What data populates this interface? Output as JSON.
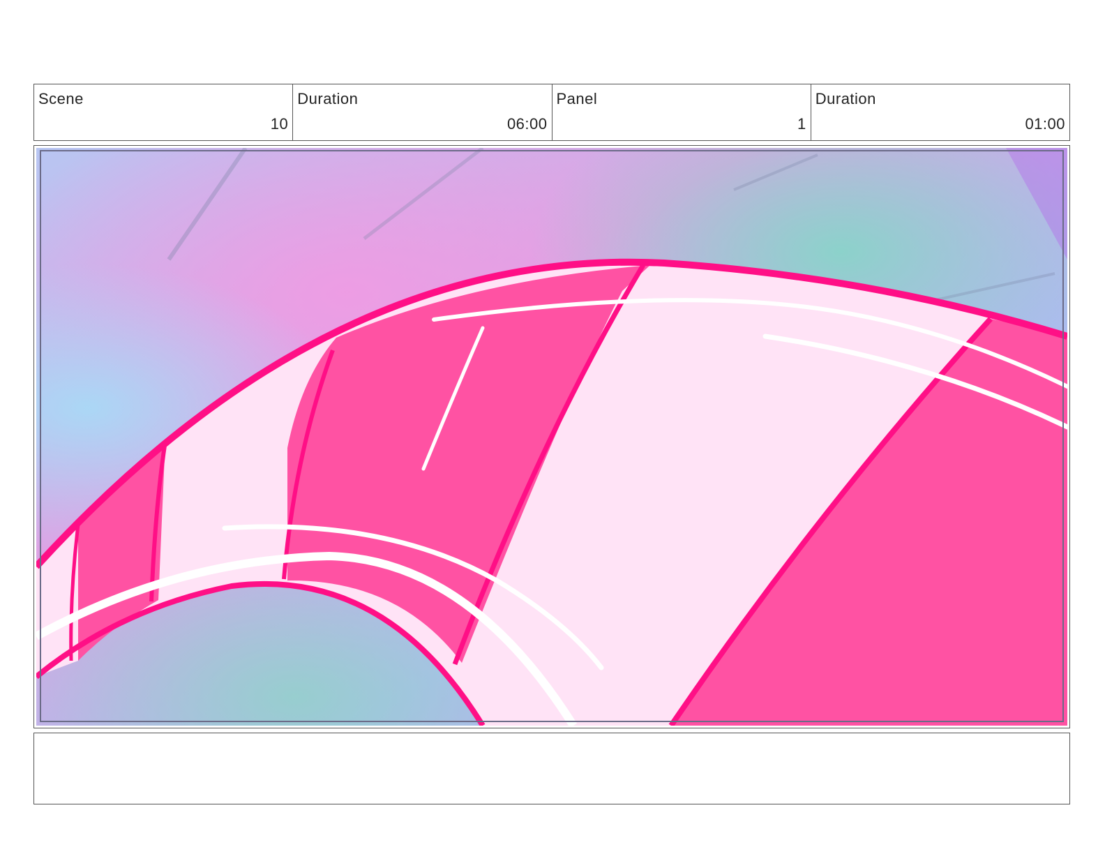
{
  "header": {
    "scene_label": "Scene",
    "scene_value": "10",
    "scene_duration_label": "Duration",
    "scene_duration_value": "06:00",
    "panel_label": "Panel",
    "panel_value": "1",
    "panel_duration_label": "Duration",
    "panel_duration_value": "01:00"
  },
  "colors": {
    "stripe_dark": "#ff52a3",
    "stripe_light": "#ffe3f6",
    "outline": "#ff0f86",
    "highlight": "#ffffff",
    "sky_violet": "#b9a7f0",
    "sky_pink": "#e59adf",
    "sky_teal": "#7fd1c6"
  },
  "notes": {
    "text": ""
  }
}
